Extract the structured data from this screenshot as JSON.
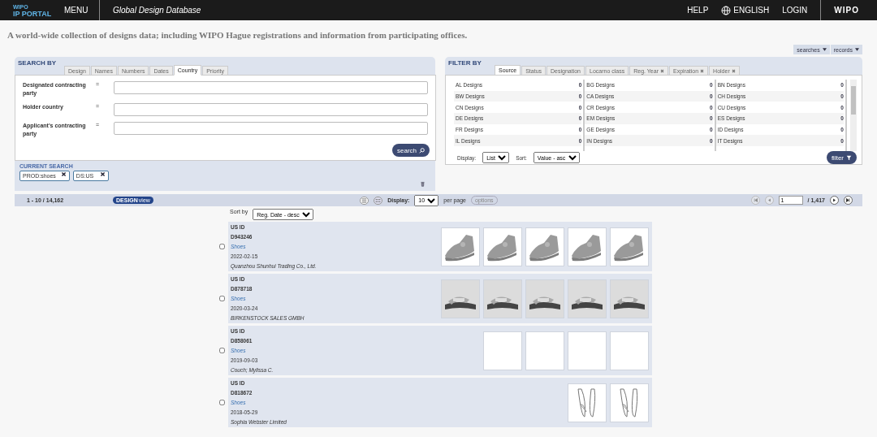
{
  "header": {
    "logo_top": "WIPO",
    "logo_bottom": "IP PORTAL",
    "menu": "MENU",
    "title": "Global Design Database",
    "links": [
      {
        "kind": "text",
        "label": "HELP"
      },
      {
        "kind": "language",
        "label": "ENGLISH"
      },
      {
        "kind": "text",
        "label": "LOGIN"
      }
    ],
    "brand": "WIPO"
  },
  "tagline": "A world-wide collection of designs data; including WIPO Hague registrations and information from participating offices.",
  "menus": [
    "searches",
    "records"
  ],
  "search_panel": {
    "title": "SEARCH BY",
    "tabs": [
      {
        "label": "Design",
        "selected": false
      },
      {
        "label": "Names",
        "selected": false
      },
      {
        "label": "Numbers",
        "selected": false
      },
      {
        "label": "Dates",
        "selected": false
      },
      {
        "label": "Country",
        "selected": true
      },
      {
        "label": "Priority",
        "selected": false
      }
    ],
    "fields": [
      {
        "label": "Designated contracting party",
        "operator": "="
      },
      {
        "label": "Holder country",
        "operator": "="
      },
      {
        "label": "Applicant's contracting party",
        "operator": "="
      }
    ],
    "button": "search",
    "current_title": "CURRENT SEARCH",
    "current_terms": [
      "PROD:shoes",
      "DS:US"
    ]
  },
  "filter_panel": {
    "title": "FILTER BY",
    "tabs": [
      {
        "label": "Source",
        "selected": true,
        "removable": false
      },
      {
        "label": "Status",
        "selected": false,
        "removable": false
      },
      {
        "label": "Designation",
        "selected": false,
        "removable": false
      },
      {
        "label": "Locarno class",
        "selected": false,
        "removable": false
      },
      {
        "label": "Reg. Year",
        "selected": false,
        "removable": true
      },
      {
        "label": "Expiration",
        "selected": false,
        "removable": true
      },
      {
        "label": "Holder",
        "selected": false,
        "removable": true
      }
    ],
    "columns": [
      [
        {
          "label": "AL Designs",
          "count": "0"
        },
        {
          "label": "BW Designs",
          "count": "0"
        },
        {
          "label": "CN Designs",
          "count": "0"
        },
        {
          "label": "DE Designs",
          "count": "0"
        },
        {
          "label": "FR Designs",
          "count": "0"
        },
        {
          "label": "IL Designs",
          "count": "0"
        }
      ],
      [
        {
          "label": "BG Designs",
          "count": "0"
        },
        {
          "label": "CA Designs",
          "count": "0"
        },
        {
          "label": "CR Designs",
          "count": "0"
        },
        {
          "label": "EM Designs",
          "count": "0"
        },
        {
          "label": "GE Designs",
          "count": "0"
        },
        {
          "label": "IN Designs",
          "count": "0"
        }
      ],
      [
        {
          "label": "BN Designs",
          "count": "0"
        },
        {
          "label": "CH Designs",
          "count": "0"
        },
        {
          "label": "CU Designs",
          "count": "0"
        },
        {
          "label": "ES Designs",
          "count": "0"
        },
        {
          "label": "ID Designs",
          "count": "0"
        },
        {
          "label": "IT Designs",
          "count": "0"
        }
      ]
    ],
    "display_label": "Display:",
    "display_value": "List",
    "sort_label": "Sort:",
    "sort_value": "Value - asc",
    "button": "filter"
  },
  "results_bar": {
    "range": "1 - 10 / 14,162",
    "badge": "DESIGN",
    "badge_sub": "view",
    "views": [
      {
        "kind": "list",
        "selected": true
      },
      {
        "kind": "grid",
        "selected": false
      }
    ],
    "display_label": "Display:",
    "per_page": "10",
    "per_page_label": "per page",
    "options": "options",
    "pager": [
      {
        "kind": "first",
        "disabled": true
      },
      {
        "kind": "prev",
        "disabled": true
      }
    ],
    "page": "1",
    "total": "/ 1,417",
    "pager_next": [
      {
        "kind": "next",
        "disabled": false
      },
      {
        "kind": "last",
        "disabled": false
      }
    ]
  },
  "sort": {
    "label": "Sort by",
    "value": "Reg. Date - desc"
  },
  "records": [
    {
      "source": "US ID",
      "number": "D943246",
      "product": "Shoes",
      "date": "2022-02-15",
      "holder": "Quanzhou Shunhui Trading Co., Ltd.",
      "checked": false
    },
    {
      "source": "US ID",
      "number": "D878718",
      "product": "Shoes",
      "date": "2020-03-24",
      "holder": "BIRKENSTOCK SALES GMBH",
      "checked": false
    },
    {
      "source": "US ID",
      "number": "D858061",
      "product": "Shoes",
      "date": "2019-09-03",
      "holder": "Couch; Mylissa C.",
      "checked": false,
      "images": [
        {
          "kind": "blank"
        },
        {
          "kind": "blank"
        },
        {
          "kind": "blank"
        },
        {
          "kind": "blank"
        }
      ]
    },
    {
      "source": "US ID",
      "number": "D818672",
      "product": "Shoes",
      "date": "2018-05-29",
      "holder": "Sophia Webster Limited",
      "checked": false
    }
  ]
}
